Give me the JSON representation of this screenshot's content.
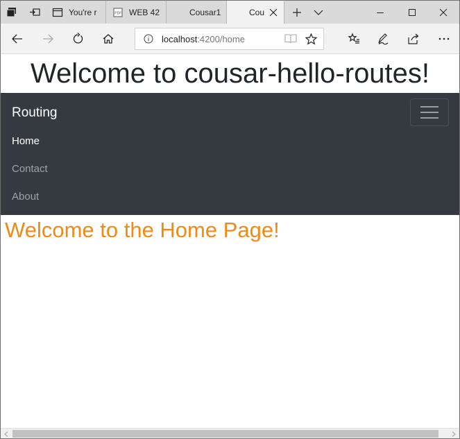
{
  "browser": {
    "tabs": [
      {
        "label": "You're r",
        "icon": "page-icon",
        "active": false
      },
      {
        "label": "WEB 42",
        "icon": "pdf-icon",
        "active": false
      },
      {
        "label": "Cousar1",
        "icon": "",
        "active": false
      },
      {
        "label": "Cou",
        "icon": "",
        "active": true
      }
    ],
    "address": {
      "host": "localhost",
      "path": ":4200/home"
    }
  },
  "page": {
    "title": "Welcome to cousar-hello-routes!",
    "nav": {
      "brand": "Routing",
      "links": [
        "Home",
        "Contact",
        "About"
      ],
      "active_link": "Home"
    },
    "welcome": "Welcome to the Home Page!"
  },
  "colors": {
    "navbar_bg": "#343a40",
    "welcome_text": "#f08a17"
  }
}
